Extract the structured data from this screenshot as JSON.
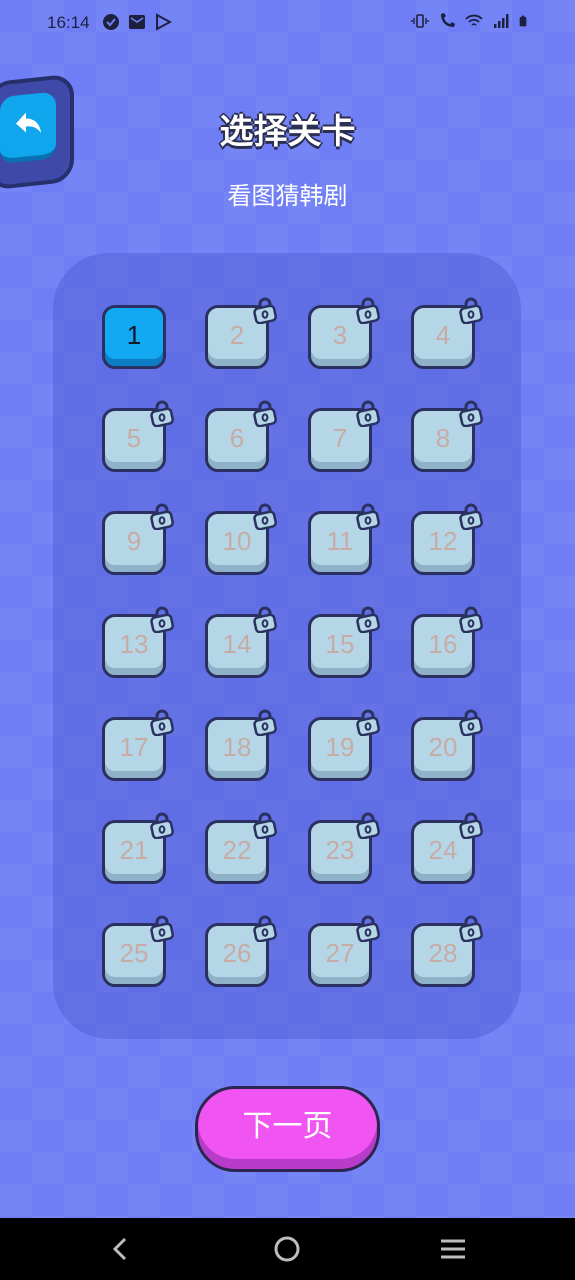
{
  "status_bar": {
    "time": "16:14",
    "left_icons": [
      "check-circle-icon",
      "mail-icon",
      "play-store-icon"
    ],
    "right_icons": [
      "vibrate-icon",
      "wifi-call-icon",
      "wifi-icon",
      "signal-icon",
      "battery-icon"
    ]
  },
  "header": {
    "back_icon": "back-arrow-icon",
    "title": "选择关卡",
    "subtitle": "看图猜韩剧"
  },
  "levels": [
    {
      "label": "1",
      "locked": false
    },
    {
      "label": "2",
      "locked": true
    },
    {
      "label": "3",
      "locked": true
    },
    {
      "label": "4",
      "locked": true
    },
    {
      "label": "5",
      "locked": true
    },
    {
      "label": "6",
      "locked": true
    },
    {
      "label": "7",
      "locked": true
    },
    {
      "label": "8",
      "locked": true
    },
    {
      "label": "9",
      "locked": true
    },
    {
      "label": "10",
      "locked": true
    },
    {
      "label": "11",
      "locked": true
    },
    {
      "label": "12",
      "locked": true
    },
    {
      "label": "13",
      "locked": true
    },
    {
      "label": "14",
      "locked": true
    },
    {
      "label": "15",
      "locked": true
    },
    {
      "label": "16",
      "locked": true
    },
    {
      "label": "17",
      "locked": true
    },
    {
      "label": "18",
      "locked": true
    },
    {
      "label": "19",
      "locked": true
    },
    {
      "label": "20",
      "locked": true
    },
    {
      "label": "21",
      "locked": true
    },
    {
      "label": "22",
      "locked": true
    },
    {
      "label": "23",
      "locked": true
    },
    {
      "label": "24",
      "locked": true
    },
    {
      "label": "25",
      "locked": true
    },
    {
      "label": "26",
      "locked": true
    },
    {
      "label": "27",
      "locked": true
    },
    {
      "label": "28",
      "locked": true
    }
  ],
  "footer": {
    "next_label": "下一页"
  },
  "nav_bar": {
    "icons": [
      "back-nav-icon",
      "home-nav-icon",
      "menu-nav-icon"
    ]
  },
  "colors": {
    "background": "#6f7ef5",
    "unlocked_tile": "#13a8f2",
    "locked_tile": "#b5d6e6",
    "next_button": "#f055f2"
  }
}
